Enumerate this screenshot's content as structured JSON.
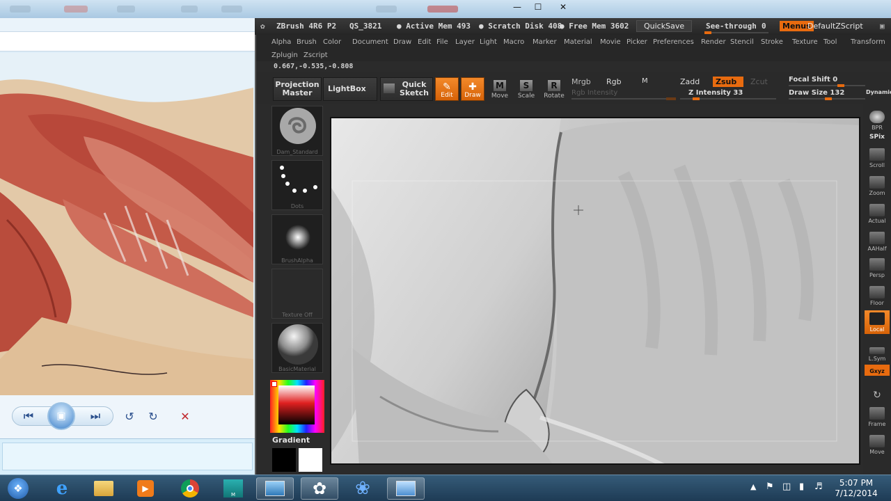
{
  "zbrush": {
    "title": "ZBrush 4R6 P2",
    "qs": "QS_3821",
    "active_mem": "● Active Mem 493",
    "scratch_disk": "● Scratch Disk 408",
    "free_mem": "● Free Mem 3602",
    "quicksave": "QuickSave",
    "see_through": "See-through",
    "see_through_value": "0",
    "menus": "Menus",
    "default_zscript": "DefaultZScript"
  },
  "menu": [
    "Alpha",
    "Brush",
    "Color",
    "Document",
    "Draw",
    "Edit",
    "File",
    "Layer",
    "Light",
    "Macro",
    "Marker",
    "Material",
    "Movie",
    "Picker",
    "Preferences",
    "Render",
    "Stencil",
    "Stroke",
    "Texture",
    "Tool",
    "Transform"
  ],
  "menu2": [
    "Zplugin",
    "Zscript"
  ],
  "coords": "0.667,-0.535,-0.808",
  "toolbar": {
    "projection_master": "Projection Master",
    "lightbox": "LightBox",
    "quick_sketch": "Quick Sketch",
    "edit": "Edit",
    "draw": "Draw",
    "move": "Move",
    "scale": "Scale",
    "rotate": "Rotate",
    "mrgb": "Mrgb",
    "rgb": "Rgb",
    "m": "M",
    "rgb_intensity": "Rgb Intensity",
    "zadd": "Zadd",
    "zsub": "Zsub",
    "zcut": "Zcut",
    "z_intensity": "Z Intensity 33",
    "focal_shift": "Focal Shift 0",
    "draw_size": "Draw Size 132",
    "dynamic": "Dynamic",
    "z_intensity_level": 0.33
  },
  "tray": {
    "brush": "Dam_Standard",
    "stroke": "Dots",
    "alpha": "BrushAlpha",
    "texture": "Texture Off",
    "material": "BasicMaterial",
    "gradient": "Gradient"
  },
  "shelf": [
    "BPR",
    "SPix",
    "Scroll",
    "Zoom",
    "Actual",
    "AAHalf",
    "Persp",
    "Floor",
    "Local",
    "L.Sym",
    "Gxyz",
    "Frame",
    "Move"
  ],
  "clock": {
    "time": "5:07 PM",
    "date": "7/12/2014"
  },
  "colors": {
    "accent": "#e86b0f",
    "taskbar": "#1e3b55"
  }
}
